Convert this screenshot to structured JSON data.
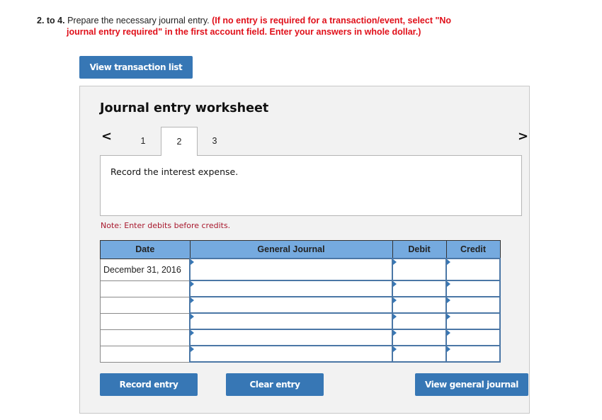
{
  "instructions": {
    "number": "2. to 4.",
    "text": " Prepare the necessary journal entry. ",
    "red_line1": "(If no entry is required for a transaction/event, select \"No",
    "red_line2": "journal entry required\" in the first account field. Enter your answers in whole dollar.)"
  },
  "buttons": {
    "view_transaction_list": "View transaction list",
    "record_entry": "Record entry",
    "clear_entry": "Clear entry",
    "view_general_journal": "View general journal"
  },
  "worksheet": {
    "title": "Journal entry worksheet",
    "prev_arrow": "<",
    "next_arrow": ">",
    "tabs": [
      {
        "label": "1",
        "active": false
      },
      {
        "label": "2",
        "active": true
      },
      {
        "label": "3",
        "active": false
      }
    ],
    "description": "Record the interest expense.",
    "note": "Note: Enter debits before credits."
  },
  "table": {
    "headers": [
      "Date",
      "General Journal",
      "Debit",
      "Credit"
    ],
    "rows": [
      {
        "date": "December 31, 2016",
        "account": "",
        "debit": "",
        "credit": ""
      },
      {
        "date": "",
        "account": "",
        "debit": "",
        "credit": ""
      },
      {
        "date": "",
        "account": "",
        "debit": "",
        "credit": ""
      },
      {
        "date": "",
        "account": "",
        "debit": "",
        "credit": ""
      },
      {
        "date": "",
        "account": "",
        "debit": "",
        "credit": ""
      },
      {
        "date": "",
        "account": "",
        "debit": "",
        "credit": ""
      }
    ]
  }
}
